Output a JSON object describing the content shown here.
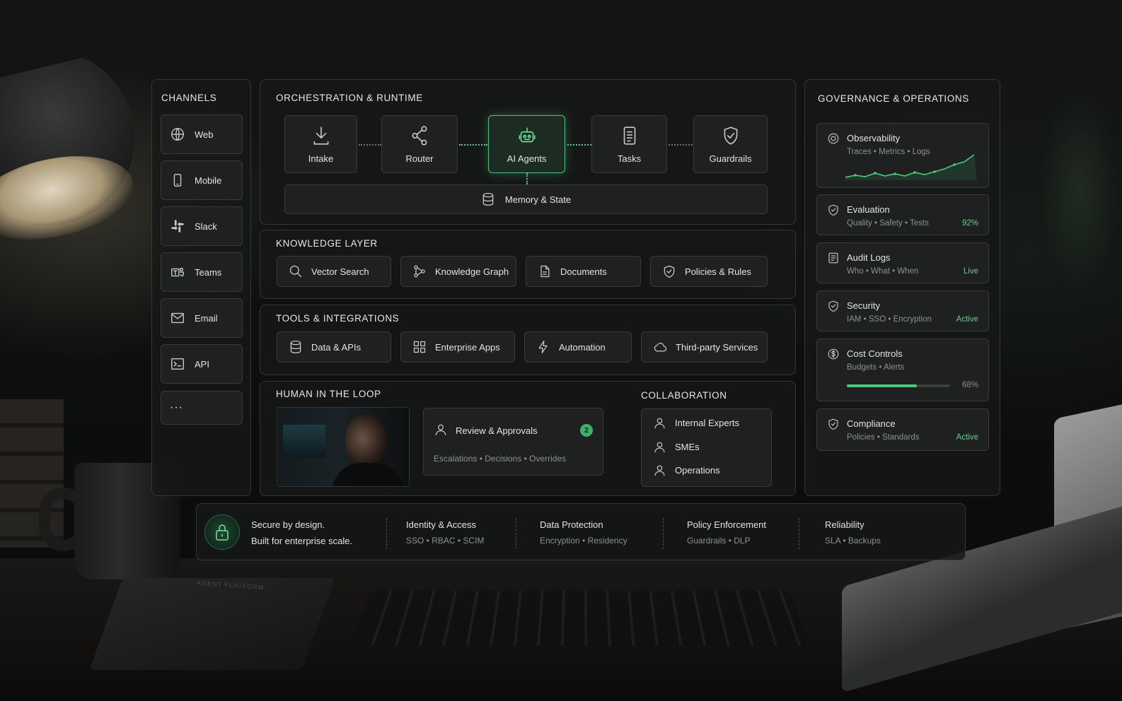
{
  "channels": {
    "heading": "CHANNELS",
    "items": [
      {
        "label": "Web",
        "icon": "globe-icon"
      },
      {
        "label": "Mobile",
        "icon": "mobile-icon"
      },
      {
        "label": "Slack",
        "icon": "slack-icon"
      },
      {
        "label": "Teams",
        "icon": "teams-icon"
      },
      {
        "label": "Email",
        "icon": "email-icon"
      },
      {
        "label": "API",
        "icon": "terminal-icon"
      }
    ],
    "more": "···"
  },
  "orchestration": {
    "heading": "ORCHESTRATION & RUNTIME",
    "nodes": [
      {
        "label": "Intake",
        "icon": "download-icon"
      },
      {
        "label": "Router",
        "icon": "share-icon"
      },
      {
        "label": "AI Agents",
        "icon": "robot-icon"
      },
      {
        "label": "Tasks",
        "icon": "document-icon"
      },
      {
        "label": "Guardrails",
        "icon": "shield-check-icon"
      }
    ],
    "memory": {
      "label": "Memory & State",
      "icon": "database-icon"
    }
  },
  "knowledge": {
    "heading": "KNOWLEDGE LAYER",
    "items": [
      {
        "label": "Vector Search",
        "icon": "search-icon"
      },
      {
        "label": "Knowledge Graph",
        "icon": "graph-icon"
      },
      {
        "label": "Documents",
        "icon": "file-icon"
      },
      {
        "label": "Policies & Rules",
        "icon": "shield-check-icon"
      }
    ]
  },
  "tools": {
    "heading": "TOOLS & INTEGRATIONS",
    "items": [
      {
        "label": "Data & APIs",
        "icon": "database-icon"
      },
      {
        "label": "Enterprise Apps",
        "icon": "grid-icon"
      },
      {
        "label": "Automation",
        "icon": "lightning-icon"
      },
      {
        "label": "Third-party Services",
        "icon": "cloud-icon"
      }
    ]
  },
  "hitl": {
    "heading": "HUMAN IN THE LOOP",
    "review": {
      "label": "Review & Approvals",
      "badge": "2",
      "details": "Escalations • Decisions • Overrides"
    }
  },
  "collaboration": {
    "heading": "COLLABORATION",
    "items": [
      "Internal Experts",
      "SMEs",
      "Operations"
    ]
  },
  "governance": {
    "heading": "GOVERNANCE & OPERATIONS",
    "observability": {
      "title": "Observability",
      "desc": "Traces • Metrics • Logs"
    },
    "evaluation": {
      "title": "Evaluation",
      "desc": "Quality • Safety • Tests",
      "status": "92%"
    },
    "audit": {
      "title": "Audit Logs",
      "desc": "Who • What • When",
      "status": "Live"
    },
    "security": {
      "title": "Security",
      "desc": "IAM • SSO • Encryption",
      "status": "Active"
    },
    "cost": {
      "title": "Cost Controls",
      "desc": "Budgets • Alerts",
      "status": "68%",
      "progress": 0.68
    },
    "compliance": {
      "title": "Compliance",
      "desc": "Policies • Standards",
      "status": "Active"
    }
  },
  "footer": {
    "tagline1": "Secure by design.",
    "tagline2": "Built for enterprise scale.",
    "columns": [
      {
        "title": "Identity & Access",
        "desc": "SSO • RBAC • SCIM"
      },
      {
        "title": "Data Protection",
        "desc": "Encryption • Residency"
      },
      {
        "title": "Policy Enforcement",
        "desc": "Guardrails • DLP"
      },
      {
        "title": "Reliability",
        "desc": "SLA • Backups"
      }
    ]
  },
  "desk": {
    "notebook_title": "AGENT PLATFORM"
  },
  "colors": {
    "accent": "#5fd08a",
    "panel": "#161817",
    "border": "#6e7672"
  }
}
